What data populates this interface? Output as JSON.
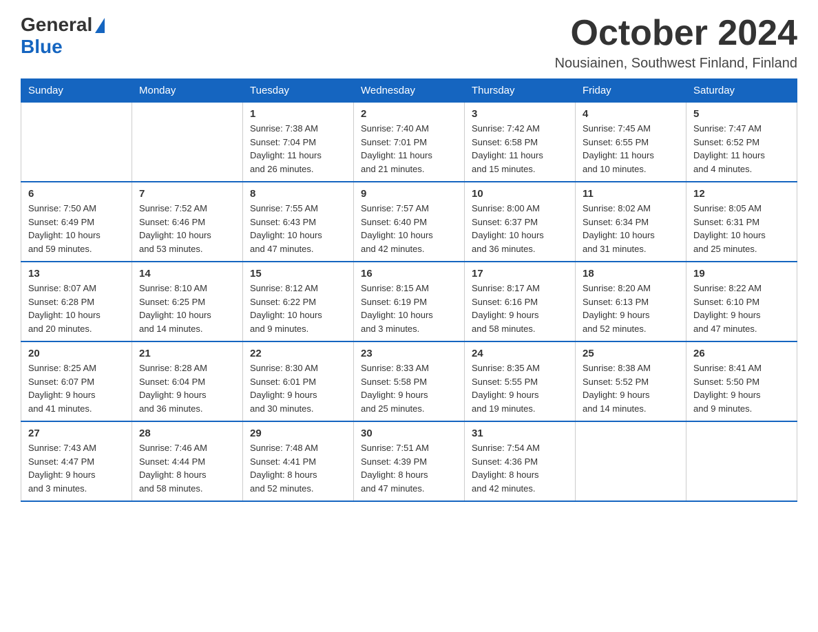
{
  "header": {
    "logo_general": "General",
    "logo_blue": "Blue",
    "month_title": "October 2024",
    "location": "Nousiainen, Southwest Finland, Finland"
  },
  "days_of_week": [
    "Sunday",
    "Monday",
    "Tuesday",
    "Wednesday",
    "Thursday",
    "Friday",
    "Saturday"
  ],
  "weeks": [
    [
      {
        "day": "",
        "info": ""
      },
      {
        "day": "",
        "info": ""
      },
      {
        "day": "1",
        "info": "Sunrise: 7:38 AM\nSunset: 7:04 PM\nDaylight: 11 hours\nand 26 minutes."
      },
      {
        "day": "2",
        "info": "Sunrise: 7:40 AM\nSunset: 7:01 PM\nDaylight: 11 hours\nand 21 minutes."
      },
      {
        "day": "3",
        "info": "Sunrise: 7:42 AM\nSunset: 6:58 PM\nDaylight: 11 hours\nand 15 minutes."
      },
      {
        "day": "4",
        "info": "Sunrise: 7:45 AM\nSunset: 6:55 PM\nDaylight: 11 hours\nand 10 minutes."
      },
      {
        "day": "5",
        "info": "Sunrise: 7:47 AM\nSunset: 6:52 PM\nDaylight: 11 hours\nand 4 minutes."
      }
    ],
    [
      {
        "day": "6",
        "info": "Sunrise: 7:50 AM\nSunset: 6:49 PM\nDaylight: 10 hours\nand 59 minutes."
      },
      {
        "day": "7",
        "info": "Sunrise: 7:52 AM\nSunset: 6:46 PM\nDaylight: 10 hours\nand 53 minutes."
      },
      {
        "day": "8",
        "info": "Sunrise: 7:55 AM\nSunset: 6:43 PM\nDaylight: 10 hours\nand 47 minutes."
      },
      {
        "day": "9",
        "info": "Sunrise: 7:57 AM\nSunset: 6:40 PM\nDaylight: 10 hours\nand 42 minutes."
      },
      {
        "day": "10",
        "info": "Sunrise: 8:00 AM\nSunset: 6:37 PM\nDaylight: 10 hours\nand 36 minutes."
      },
      {
        "day": "11",
        "info": "Sunrise: 8:02 AM\nSunset: 6:34 PM\nDaylight: 10 hours\nand 31 minutes."
      },
      {
        "day": "12",
        "info": "Sunrise: 8:05 AM\nSunset: 6:31 PM\nDaylight: 10 hours\nand 25 minutes."
      }
    ],
    [
      {
        "day": "13",
        "info": "Sunrise: 8:07 AM\nSunset: 6:28 PM\nDaylight: 10 hours\nand 20 minutes."
      },
      {
        "day": "14",
        "info": "Sunrise: 8:10 AM\nSunset: 6:25 PM\nDaylight: 10 hours\nand 14 minutes."
      },
      {
        "day": "15",
        "info": "Sunrise: 8:12 AM\nSunset: 6:22 PM\nDaylight: 10 hours\nand 9 minutes."
      },
      {
        "day": "16",
        "info": "Sunrise: 8:15 AM\nSunset: 6:19 PM\nDaylight: 10 hours\nand 3 minutes."
      },
      {
        "day": "17",
        "info": "Sunrise: 8:17 AM\nSunset: 6:16 PM\nDaylight: 9 hours\nand 58 minutes."
      },
      {
        "day": "18",
        "info": "Sunrise: 8:20 AM\nSunset: 6:13 PM\nDaylight: 9 hours\nand 52 minutes."
      },
      {
        "day": "19",
        "info": "Sunrise: 8:22 AM\nSunset: 6:10 PM\nDaylight: 9 hours\nand 47 minutes."
      }
    ],
    [
      {
        "day": "20",
        "info": "Sunrise: 8:25 AM\nSunset: 6:07 PM\nDaylight: 9 hours\nand 41 minutes."
      },
      {
        "day": "21",
        "info": "Sunrise: 8:28 AM\nSunset: 6:04 PM\nDaylight: 9 hours\nand 36 minutes."
      },
      {
        "day": "22",
        "info": "Sunrise: 8:30 AM\nSunset: 6:01 PM\nDaylight: 9 hours\nand 30 minutes."
      },
      {
        "day": "23",
        "info": "Sunrise: 8:33 AM\nSunset: 5:58 PM\nDaylight: 9 hours\nand 25 minutes."
      },
      {
        "day": "24",
        "info": "Sunrise: 8:35 AM\nSunset: 5:55 PM\nDaylight: 9 hours\nand 19 minutes."
      },
      {
        "day": "25",
        "info": "Sunrise: 8:38 AM\nSunset: 5:52 PM\nDaylight: 9 hours\nand 14 minutes."
      },
      {
        "day": "26",
        "info": "Sunrise: 8:41 AM\nSunset: 5:50 PM\nDaylight: 9 hours\nand 9 minutes."
      }
    ],
    [
      {
        "day": "27",
        "info": "Sunrise: 7:43 AM\nSunset: 4:47 PM\nDaylight: 9 hours\nand 3 minutes."
      },
      {
        "day": "28",
        "info": "Sunrise: 7:46 AM\nSunset: 4:44 PM\nDaylight: 8 hours\nand 58 minutes."
      },
      {
        "day": "29",
        "info": "Sunrise: 7:48 AM\nSunset: 4:41 PM\nDaylight: 8 hours\nand 52 minutes."
      },
      {
        "day": "30",
        "info": "Sunrise: 7:51 AM\nSunset: 4:39 PM\nDaylight: 8 hours\nand 47 minutes."
      },
      {
        "day": "31",
        "info": "Sunrise: 7:54 AM\nSunset: 4:36 PM\nDaylight: 8 hours\nand 42 minutes."
      },
      {
        "day": "",
        "info": ""
      },
      {
        "day": "",
        "info": ""
      }
    ]
  ]
}
